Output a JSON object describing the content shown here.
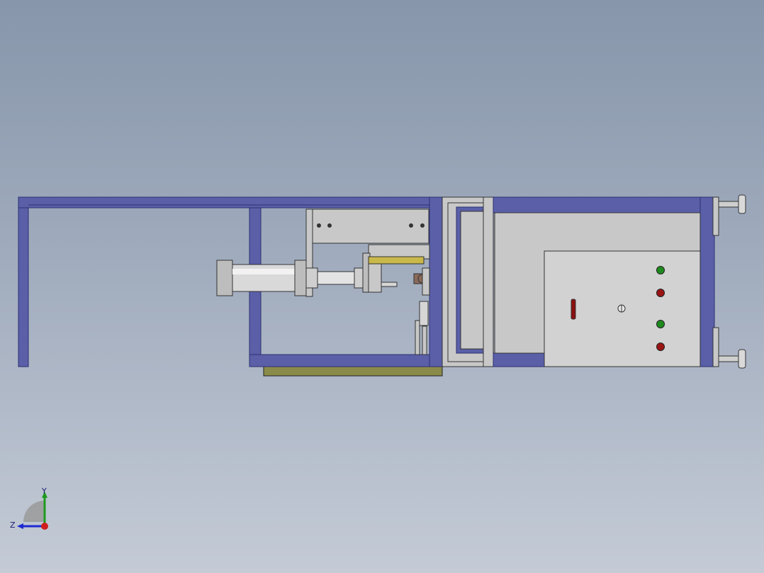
{
  "viewport": {
    "background_top": "#8796ab",
    "background_bottom": "#c4cbd6"
  },
  "model": {
    "frame_color": "#5a5fa8",
    "frame_edge": "#2d3070",
    "panel_color": "#c8c8c8",
    "base_color": "#8a8a4a",
    "indicators": [
      {
        "name": "indicator-light-green-1",
        "color": "#1f8a1f"
      },
      {
        "name": "indicator-light-red-1",
        "color": "#9a1414"
      },
      {
        "name": "indicator-light-green-2",
        "color": "#1f8a1f"
      },
      {
        "name": "indicator-light-red-2",
        "color": "#9a1414"
      }
    ],
    "switch_color": "#8a1010"
  },
  "triad": {
    "y_label": "Y",
    "z_label": "Z",
    "y_color": "#1e9a1e",
    "z_color": "#1e2ad0",
    "x_color": "#d01e1e"
  }
}
